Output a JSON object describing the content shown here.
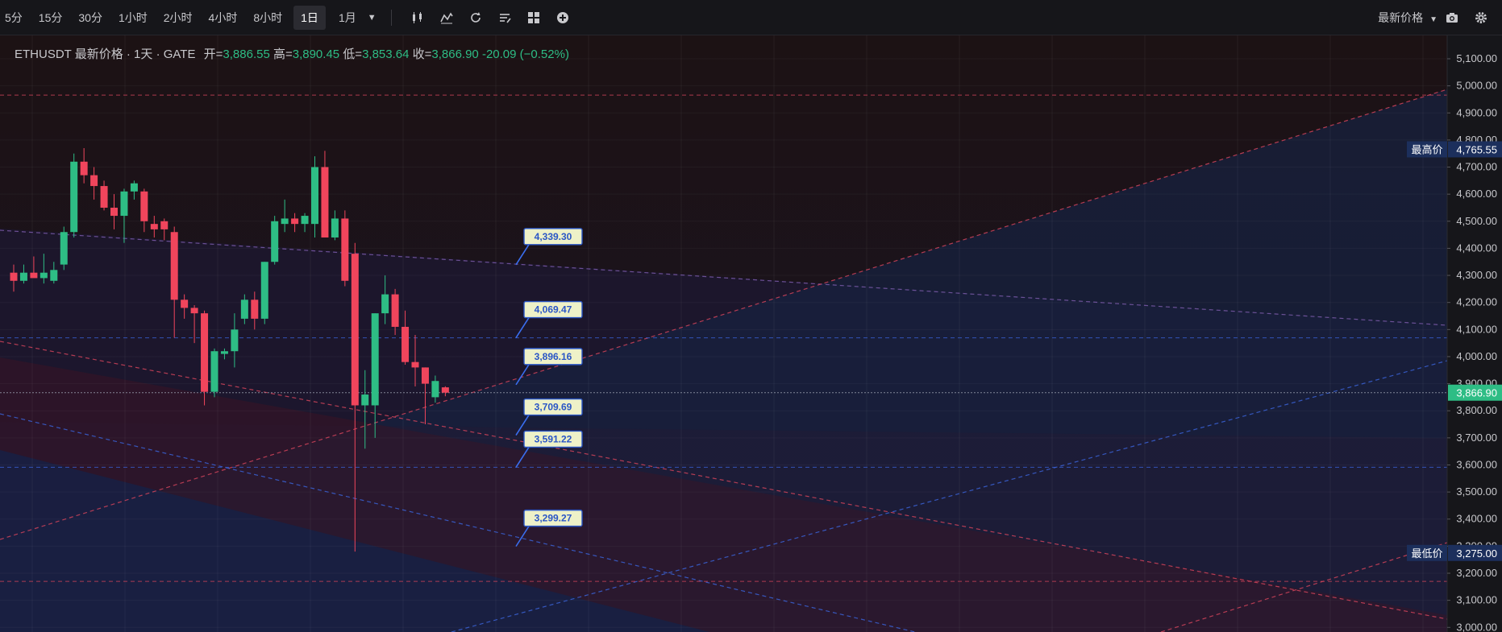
{
  "toolbar": {
    "timeframes": [
      "5分",
      "15分",
      "30分",
      "1小时",
      "2小时",
      "4小时",
      "8小时",
      "1日",
      "1月"
    ],
    "active_timeframe": "1日",
    "price_mode": "最新价格",
    "icons": [
      "candles-icon",
      "indicators-icon",
      "replay-icon",
      "drawing-list-icon",
      "layout-grid-icon",
      "add-circle-icon",
      "camera-icon",
      "settings-icon"
    ]
  },
  "legend": {
    "symbol": "ETHUSDT 最新价格 · 1天 · GATE",
    "open_label": "开=",
    "open": "3,886.55",
    "high_label": "高=",
    "high": "3,890.45",
    "low_label": "低=",
    "low": "3,853.64",
    "close_label": "收=",
    "close": "3,866.90",
    "change": "-20.09 (−0.52%)"
  },
  "colors": {
    "up": "#2ebd85",
    "down": "#f0455c",
    "background": "#131316",
    "last_price": "#2ebd85",
    "tag_blue": "#1c2f5c",
    "callout_border": "#2a56c6"
  },
  "chart_data": {
    "type": "candlestick",
    "ylim": [
      3000,
      5150
    ],
    "yticks": [
      "5,100.00",
      "5,000.00",
      "4,900.00",
      "4,800.00",
      "4,700.00",
      "4,600.00",
      "4,500.00",
      "4,400.00",
      "4,300.00",
      "4,200.00",
      "4,100.00",
      "4,000.00",
      "3,900.00",
      "3,800.00",
      "3,700.00",
      "3,600.00",
      "3,500.00",
      "3,400.00",
      "3,300.00",
      "3,200.00",
      "3,100.00",
      "3,000.00"
    ],
    "tick_values": [
      5100,
      5000,
      4900,
      4800,
      4700,
      4600,
      4500,
      4400,
      4300,
      4200,
      4100,
      4000,
      3900,
      3800,
      3700,
      3600,
      3500,
      3400,
      3300,
      3200,
      3100,
      3000
    ],
    "candles": [
      {
        "o": 4310,
        "h": 4340,
        "l": 4240,
        "c": 4280
      },
      {
        "o": 4280,
        "h": 4340,
        "l": 4270,
        "c": 4310
      },
      {
        "o": 4310,
        "h": 4370,
        "l": 4300,
        "c": 4290
      },
      {
        "o": 4290,
        "h": 4380,
        "l": 4270,
        "c": 4310
      },
      {
        "o": 4280,
        "h": 4350,
        "l": 4270,
        "c": 4320
      },
      {
        "o": 4340,
        "h": 4480,
        "l": 4320,
        "c": 4460
      },
      {
        "o": 4460,
        "h": 4750,
        "l": 4440,
        "c": 4720
      },
      {
        "o": 4720,
        "h": 4770,
        "l": 4640,
        "c": 4670
      },
      {
        "o": 4670,
        "h": 4700,
        "l": 4580,
        "c": 4630
      },
      {
        "o": 4630,
        "h": 4650,
        "l": 4540,
        "c": 4550
      },
      {
        "o": 4550,
        "h": 4600,
        "l": 4470,
        "c": 4520
      },
      {
        "o": 4520,
        "h": 4620,
        "l": 4420,
        "c": 4610
      },
      {
        "o": 4610,
        "h": 4650,
        "l": 4580,
        "c": 4640
      },
      {
        "o": 4610,
        "h": 4620,
        "l": 4460,
        "c": 4500
      },
      {
        "o": 4490,
        "h": 4520,
        "l": 4440,
        "c": 4470
      },
      {
        "o": 4500,
        "h": 4510,
        "l": 4430,
        "c": 4470
      },
      {
        "o": 4460,
        "h": 4480,
        "l": 4070,
        "c": 4210
      },
      {
        "o": 4210,
        "h": 4230,
        "l": 4140,
        "c": 4180
      },
      {
        "o": 4180,
        "h": 4190,
        "l": 4050,
        "c": 4160
      },
      {
        "o": 4160,
        "h": 4170,
        "l": 3820,
        "c": 3870
      },
      {
        "o": 3870,
        "h": 4030,
        "l": 3850,
        "c": 4020
      },
      {
        "o": 4010,
        "h": 4030,
        "l": 3990,
        "c": 4020
      },
      {
        "o": 4020,
        "h": 4160,
        "l": 3960,
        "c": 4100
      },
      {
        "o": 4140,
        "h": 4230,
        "l": 4120,
        "c": 4210
      },
      {
        "o": 4210,
        "h": 4240,
        "l": 4100,
        "c": 4140
      },
      {
        "o": 4140,
        "h": 4350,
        "l": 4120,
        "c": 4350
      },
      {
        "o": 4350,
        "h": 4520,
        "l": 4340,
        "c": 4500
      },
      {
        "o": 4490,
        "h": 4580,
        "l": 4460,
        "c": 4510
      },
      {
        "o": 4510,
        "h": 4530,
        "l": 4460,
        "c": 4490
      },
      {
        "o": 4490,
        "h": 4530,
        "l": 4460,
        "c": 4520
      },
      {
        "o": 4490,
        "h": 4740,
        "l": 4440,
        "c": 4700
      },
      {
        "o": 4700,
        "h": 4760,
        "l": 4460,
        "c": 4440
      },
      {
        "o": 4440,
        "h": 4540,
        "l": 4430,
        "c": 4510
      },
      {
        "o": 4510,
        "h": 4540,
        "l": 4260,
        "c": 4280
      },
      {
        "o": 4380,
        "h": 4420,
        "l": 3280,
        "c": 3820
      },
      {
        "o": 3820,
        "h": 3950,
        "l": 3660,
        "c": 3860
      },
      {
        "o": 3820,
        "h": 4160,
        "l": 3700,
        "c": 4160
      },
      {
        "o": 4160,
        "h": 4300,
        "l": 4120,
        "c": 4230
      },
      {
        "o": 4230,
        "h": 4250,
        "l": 4080,
        "c": 4110
      },
      {
        "o": 4110,
        "h": 4170,
        "l": 3970,
        "c": 3980
      },
      {
        "o": 3980,
        "h": 4080,
        "l": 3890,
        "c": 3960
      },
      {
        "o": 3960,
        "h": 3960,
        "l": 3750,
        "c": 3900
      },
      {
        "o": 3850,
        "h": 3930,
        "l": 3830,
        "c": 3910
      },
      {
        "o": 3886.55,
        "h": 3890.45,
        "l": 3853.64,
        "c": 3866.9
      }
    ],
    "h_lines": [
      4966,
      4069.47,
      3866.9,
      3591.22,
      3170
    ],
    "price_tags": [
      {
        "label": "最高价",
        "value": "4,765.55",
        "price": 4765.55
      },
      {
        "label": "最低价",
        "value": "3,275.00",
        "price": 3275.0
      }
    ],
    "last_price": {
      "value": "3,866.90",
      "price": 3866.9
    },
    "callouts": [
      "4,339.30",
      "4,069.47",
      "3,896.16",
      "3,709.69",
      "3,591.22",
      "3,299.27"
    ],
    "callout_prices": [
      4339.3,
      4069.47,
      3896.16,
      3709.69,
      3591.22,
      3299.27
    ]
  }
}
